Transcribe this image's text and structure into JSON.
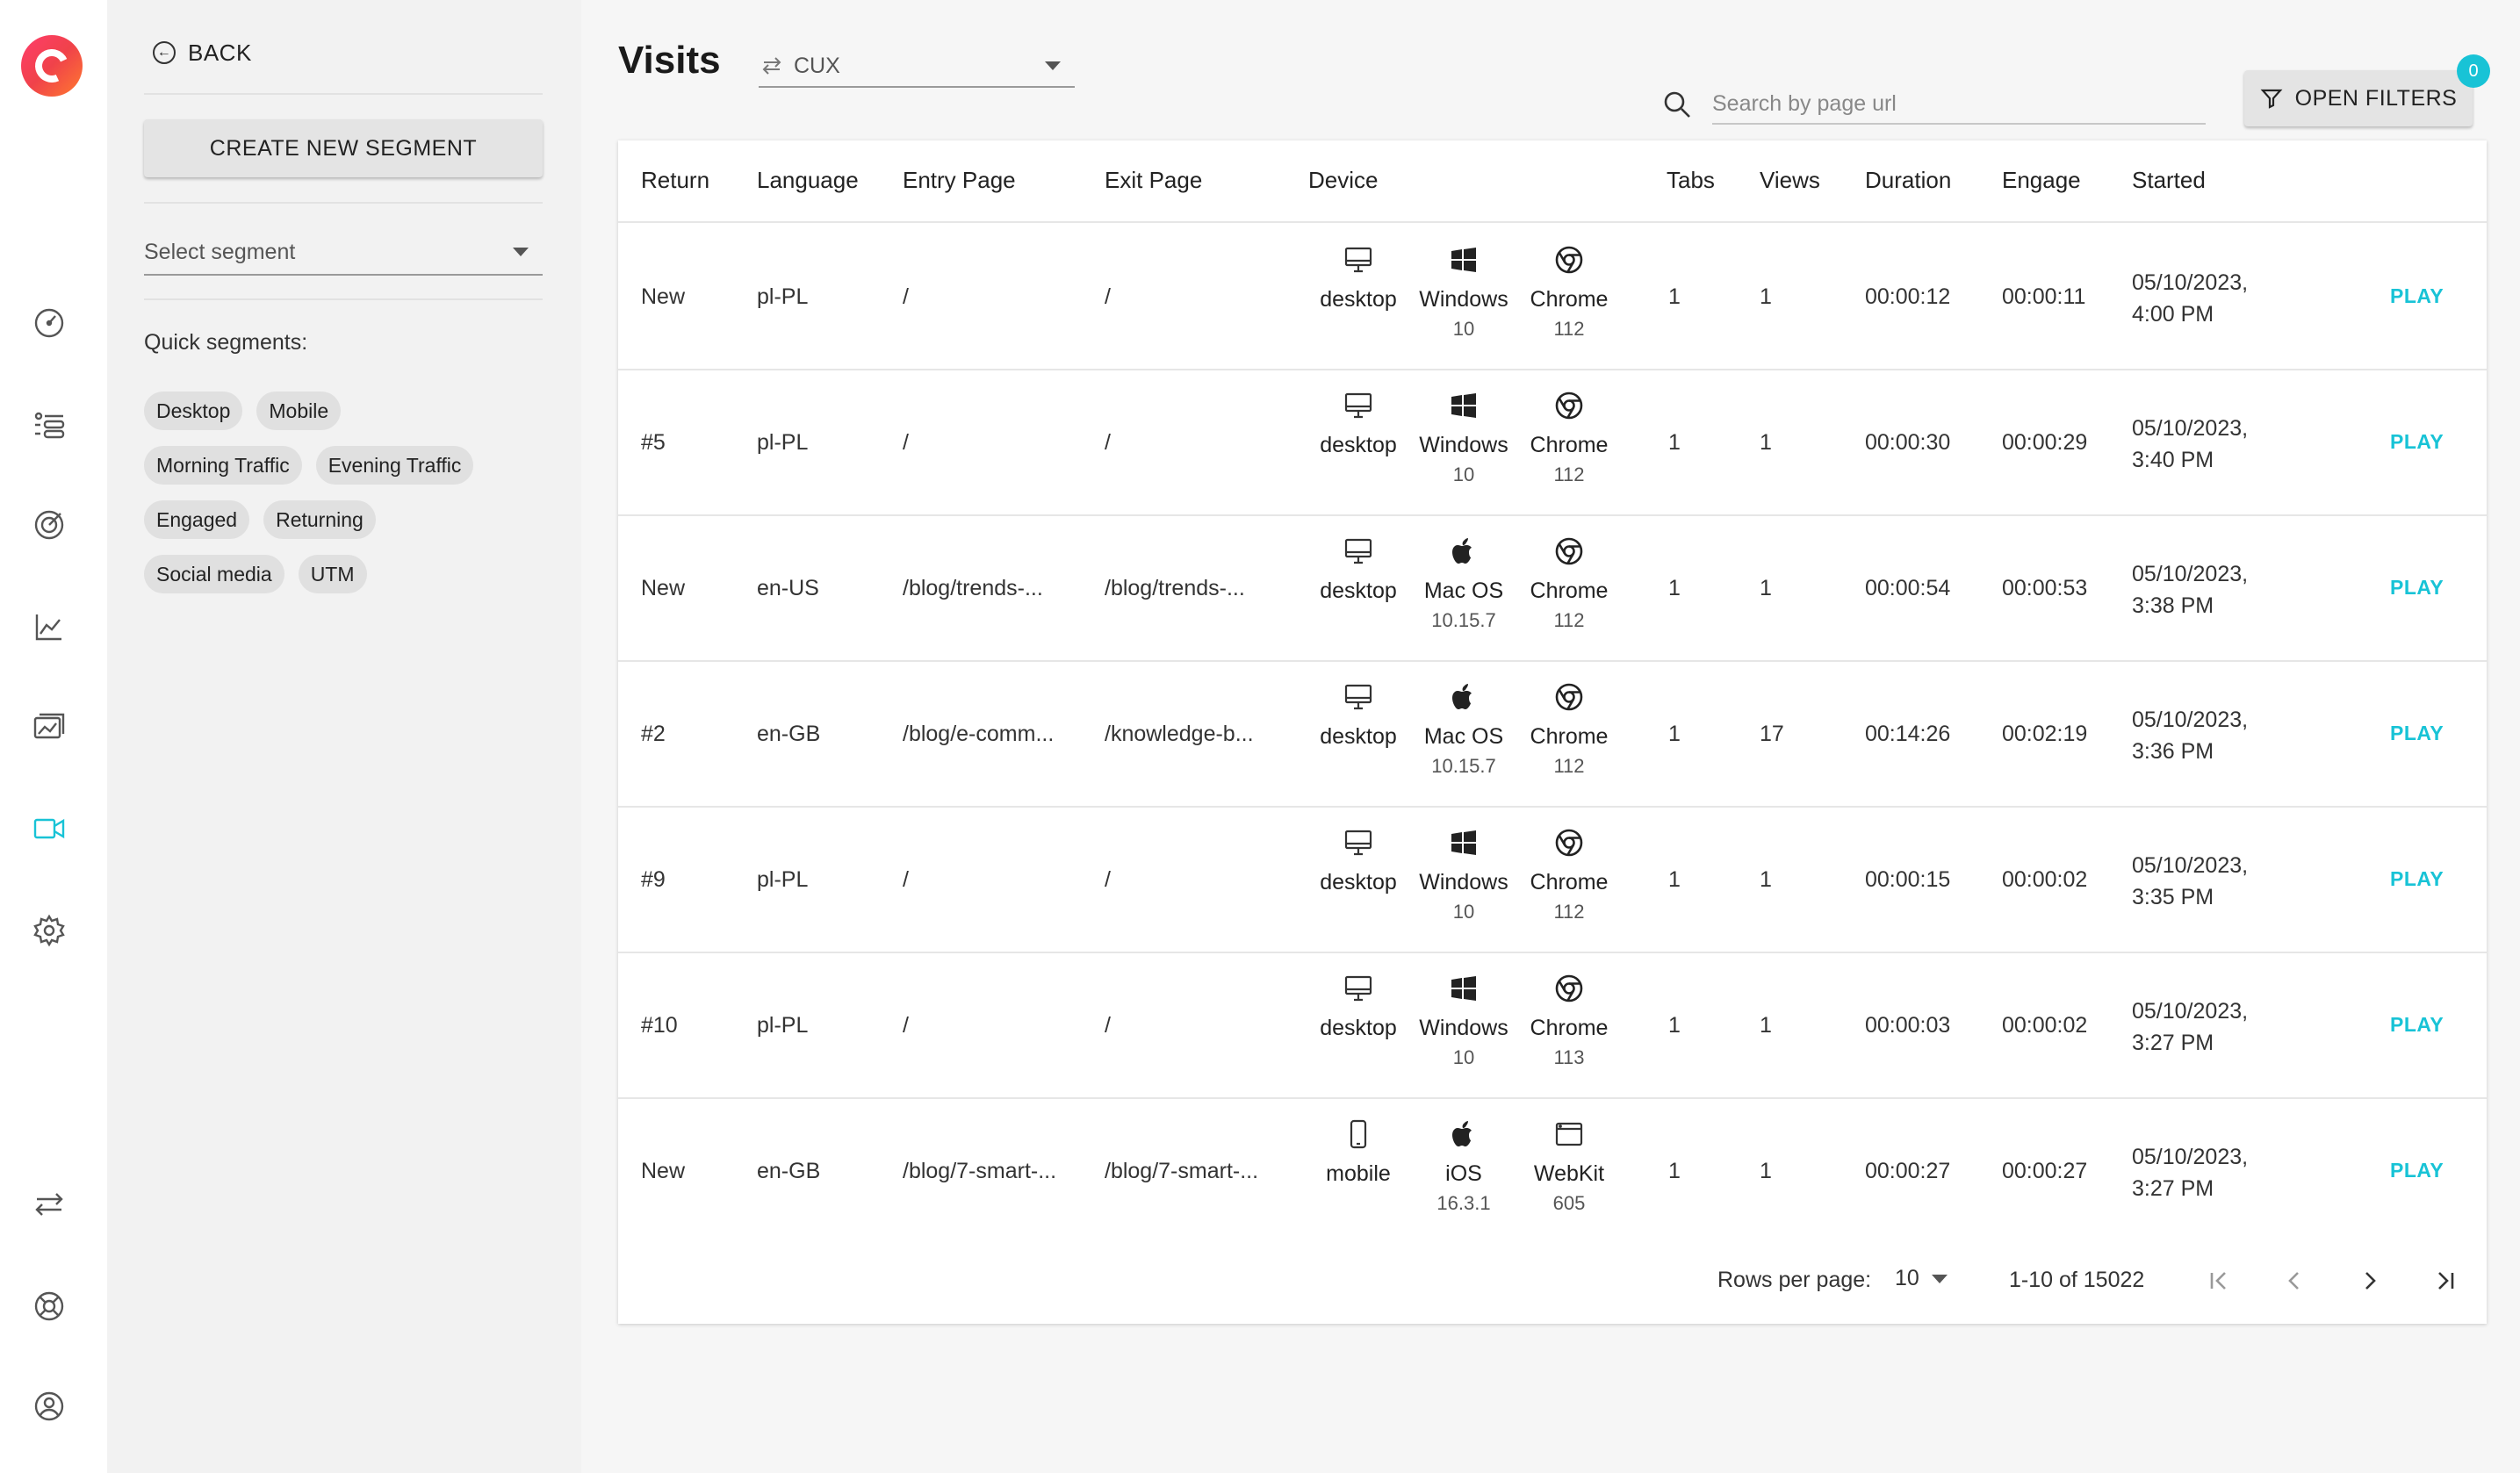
{
  "colors": {
    "accent": "#18c3d6",
    "logo_start": "#ff3d6b",
    "logo_end": "#ff7a2f"
  },
  "rail": {
    "icons": [
      "dashboard-icon",
      "funnels-icon",
      "goals-icon",
      "analytics-icon",
      "heatmaps-icon",
      "recordings-icon",
      "settings-icon",
      "switch-icon",
      "help-icon",
      "account-icon"
    ]
  },
  "segments": {
    "back_label": "BACK",
    "create_label": "CREATE NEW SEGMENT",
    "select_placeholder": "Select segment",
    "quick_label": "Quick segments:",
    "chips": [
      "Desktop",
      "Mobile",
      "Morning Traffic",
      "Evening Traffic",
      "Engaged",
      "Returning",
      "Social media",
      "UTM"
    ]
  },
  "header": {
    "title": "Visits",
    "source_value": "CUX",
    "search_placeholder": "Search by page url",
    "filters_label": "OPEN FILTERS",
    "filters_count": "0"
  },
  "table": {
    "columns": [
      "Return",
      "Language",
      "Entry Page",
      "Exit Page",
      "Device",
      "Tabs",
      "Views",
      "Duration",
      "Engage",
      "Started"
    ],
    "play_label": "PLAY",
    "rows": [
      {
        "return": "New",
        "language": "pl-PL",
        "entry": "/",
        "exit": "/",
        "device": "desktop",
        "device_icon": "desktop-icon",
        "os": "Windows",
        "os_ver": "10",
        "os_icon": "windows-icon",
        "browser": "Chrome",
        "browser_ver": "112",
        "browser_icon": "chrome-icon",
        "tabs": "1",
        "views": "1",
        "duration": "00:00:12",
        "engage": "00:00:11",
        "date": "05/10/2023,",
        "time": "4:00 PM"
      },
      {
        "return": "#5",
        "language": "pl-PL",
        "entry": "/",
        "exit": "/",
        "device": "desktop",
        "device_icon": "desktop-icon",
        "os": "Windows",
        "os_ver": "10",
        "os_icon": "windows-icon",
        "browser": "Chrome",
        "browser_ver": "112",
        "browser_icon": "chrome-icon",
        "tabs": "1",
        "views": "1",
        "duration": "00:00:30",
        "engage": "00:00:29",
        "date": "05/10/2023,",
        "time": "3:40 PM"
      },
      {
        "return": "New",
        "language": "en-US",
        "entry": "/blog/trends-...",
        "exit": "/blog/trends-...",
        "device": "desktop",
        "device_icon": "desktop-icon",
        "os": "Mac OS",
        "os_ver": "10.15.7",
        "os_icon": "apple-icon",
        "browser": "Chrome",
        "browser_ver": "112",
        "browser_icon": "chrome-icon",
        "tabs": "1",
        "views": "1",
        "duration": "00:00:54",
        "engage": "00:00:53",
        "date": "05/10/2023,",
        "time": "3:38 PM"
      },
      {
        "return": "#2",
        "language": "en-GB",
        "entry": "/blog/e-comm...",
        "exit": "/knowledge-b...",
        "device": "desktop",
        "device_icon": "desktop-icon",
        "os": "Mac OS",
        "os_ver": "10.15.7",
        "os_icon": "apple-icon",
        "browser": "Chrome",
        "browser_ver": "112",
        "browser_icon": "chrome-icon",
        "tabs": "1",
        "views": "17",
        "duration": "00:14:26",
        "engage": "00:02:19",
        "date": "05/10/2023,",
        "time": "3:36 PM"
      },
      {
        "return": "#9",
        "language": "pl-PL",
        "entry": "/",
        "exit": "/",
        "device": "desktop",
        "device_icon": "desktop-icon",
        "os": "Windows",
        "os_ver": "10",
        "os_icon": "windows-icon",
        "browser": "Chrome",
        "browser_ver": "112",
        "browser_icon": "chrome-icon",
        "tabs": "1",
        "views": "1",
        "duration": "00:00:15",
        "engage": "00:00:02",
        "date": "05/10/2023,",
        "time": "3:35 PM"
      },
      {
        "return": "#10",
        "language": "pl-PL",
        "entry": "/",
        "exit": "/",
        "device": "desktop",
        "device_icon": "desktop-icon",
        "os": "Windows",
        "os_ver": "10",
        "os_icon": "windows-icon",
        "browser": "Chrome",
        "browser_ver": "113",
        "browser_icon": "chrome-icon",
        "tabs": "1",
        "views": "1",
        "duration": "00:00:03",
        "engage": "00:00:02",
        "date": "05/10/2023,",
        "time": "3:27 PM"
      },
      {
        "return": "New",
        "language": "en-GB",
        "entry": "/blog/7-smart-...",
        "exit": "/blog/7-smart-...",
        "device": "mobile",
        "device_icon": "mobile-icon",
        "os": "iOS",
        "os_ver": "16.3.1",
        "os_icon": "apple-icon",
        "browser": "WebKit",
        "browser_ver": "605",
        "browser_icon": "webkit-icon",
        "tabs": "1",
        "views": "1",
        "duration": "00:00:27",
        "engage": "00:00:27",
        "date": "05/10/2023,",
        "time": "3:27 PM"
      }
    ]
  },
  "pagination": {
    "rows_per_page_label": "Rows per page:",
    "rows_per_page_value": "10",
    "range": "1-10 of 15022"
  }
}
